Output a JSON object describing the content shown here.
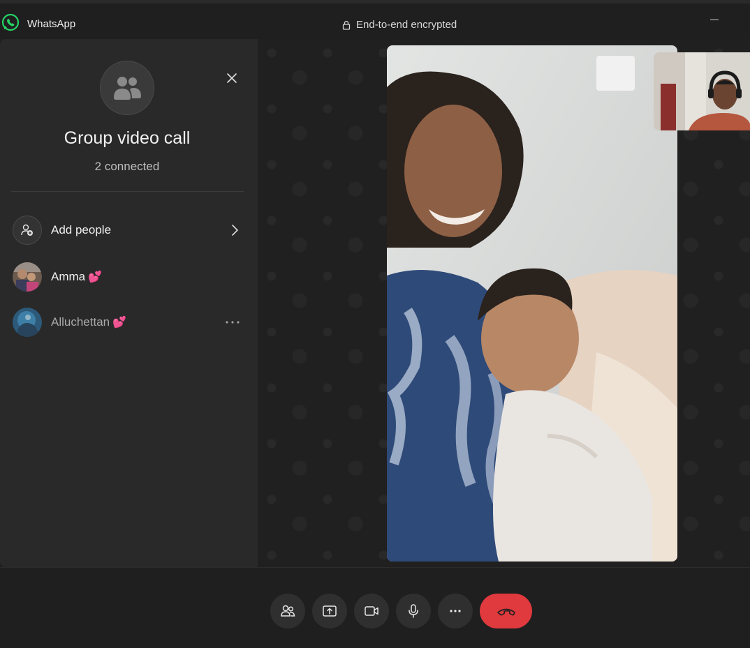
{
  "titlebar": {
    "app_name": "WhatsApp",
    "encryption": "End-to-end encrypted"
  },
  "panel": {
    "title": "Group video call",
    "subtitle": "2 connected",
    "add_people": "Add people",
    "participants": [
      {
        "name": "Amma"
      },
      {
        "name": "Alluchettan"
      }
    ]
  },
  "controls": {
    "participants_icon": "people-icon",
    "share_icon": "share-screen-icon",
    "video_icon": "video-camera-icon",
    "mic_icon": "microphone-icon",
    "more_icon": "more-icon",
    "end_icon": "hang-up-icon"
  },
  "colors": {
    "brand": "#25d366",
    "end_call": "#e0393e",
    "panel_bg": "#292929",
    "stage_bg": "#202020"
  }
}
